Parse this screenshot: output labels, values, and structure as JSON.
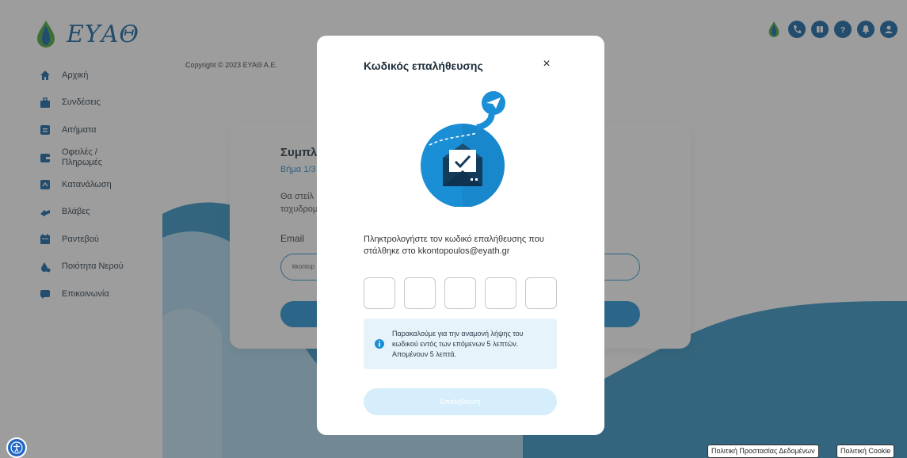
{
  "brand": {
    "name": "ΕΥΑΘ"
  },
  "sidebar": {
    "items": [
      {
        "label": "Αρχική",
        "icon": "home-icon"
      },
      {
        "label": "Συνδέσεις",
        "icon": "briefcase-icon"
      },
      {
        "label": "Αιτήματα",
        "icon": "document-icon"
      },
      {
        "label": "Οφειλές / Πληρωμές",
        "icon": "wallet-icon"
      },
      {
        "label": "Κατανάλωση",
        "icon": "meter-icon"
      },
      {
        "label": "Βλάβες",
        "icon": "tools-icon"
      },
      {
        "label": "Ραντεβού",
        "icon": "calendar-icon"
      },
      {
        "label": "Ποιότητα Νερού",
        "icon": "water-drop-icon"
      },
      {
        "label": "Επικοινωνία",
        "icon": "chat-icon"
      }
    ]
  },
  "copyright": "Copyright © 2023 ΕΥΑΘ Α.Ε.",
  "topbar": {
    "icons": [
      "drop-logo-icon",
      "phone-icon",
      "book-icon",
      "help-icon",
      "bell-icon",
      "user-icon"
    ]
  },
  "background_card": {
    "title": "Συμπλ",
    "step": "Βήμα 1/3",
    "text": "Θα στείλ\nταχυδρομ",
    "email_label": "Email",
    "email_value": "kkontop"
  },
  "modal": {
    "title": "Κωδικός επαλήθευσης",
    "close": "×",
    "prompt": "Πληκτρολογήστε τον κωδικό επαλήθευσης που στάλθηκε στο kkontopoulos@eyath.gr",
    "code_boxes": [
      "",
      "",
      "",
      "",
      ""
    ],
    "notice": "Παρακαλούμε για την αναμονή λήψης του κωδικού εντός των επόμενων 5 λεπτών. Απομένουν 5 λεπτά.",
    "verify_label": "Επαλήθευση"
  },
  "footer": {
    "privacy_label": "Πολιτική Προστασίας Δεδομένων",
    "cookie_label": "Πολιτική Cookie"
  },
  "colors": {
    "primary": "#0b5fa0",
    "accent": "#1a8fd5",
    "brand_green": "#3fa535"
  }
}
